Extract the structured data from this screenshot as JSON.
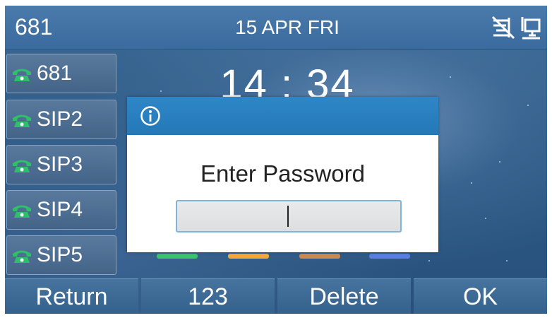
{
  "statusbar": {
    "account": "681",
    "date": "15 APR FRI",
    "icons": [
      "network-disconnected-icon",
      "ethernet-icon"
    ]
  },
  "clock": "14 : 34",
  "line_keys": [
    {
      "icon": "phone-icon",
      "label": "681"
    },
    {
      "icon": "phone-icon",
      "label": "SIP2"
    },
    {
      "icon": "phone-icon",
      "label": "SIP3"
    },
    {
      "icon": "phone-icon",
      "label": "SIP4"
    },
    {
      "icon": "phone-icon",
      "label": "SIP5"
    }
  ],
  "dialog": {
    "icon": "info-icon",
    "title": "Enter Password",
    "input_value": ""
  },
  "softkeys": [
    "Return",
    "123",
    "Delete",
    "OK"
  ],
  "colors": {
    "dialog_header": "#2479b8",
    "input_border": "#7fb4dc",
    "phone_icon": "#2fbf6b",
    "idle_bars": [
      "#39c36a",
      "#f2a93b",
      "#c98a52",
      "#5b7fe0"
    ]
  }
}
